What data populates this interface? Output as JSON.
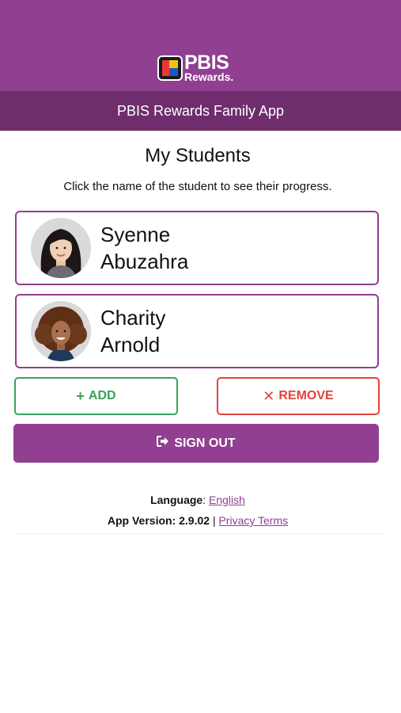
{
  "header": {
    "logo_line1": "PBIS",
    "logo_line2": "Rewards.",
    "app_title": "PBIS Rewards Family App"
  },
  "main": {
    "title": "My Students",
    "instructions": "Click the name of the student to see their progress.",
    "students": [
      {
        "first_name": "Syenne",
        "last_name": "Abuzahra"
      },
      {
        "first_name": "Charity",
        "last_name": "Arnold"
      }
    ],
    "add_label": "ADD",
    "remove_label": "REMOVE",
    "signout_label": "SIGN OUT"
  },
  "footer": {
    "language_label": "Language",
    "language_value": "English",
    "version_label": "App Version: 2.9.02",
    "separator": "|",
    "privacy_link": "Privacy Terms"
  },
  "colors": {
    "brand_purple": "#913f91",
    "app_bar_purple": "#6f2d6d",
    "add_green": "#3aa35a",
    "remove_red": "#e0433a"
  },
  "icons": {
    "add": "plus-icon",
    "remove": "x-icon",
    "signout": "sign-out-icon"
  }
}
